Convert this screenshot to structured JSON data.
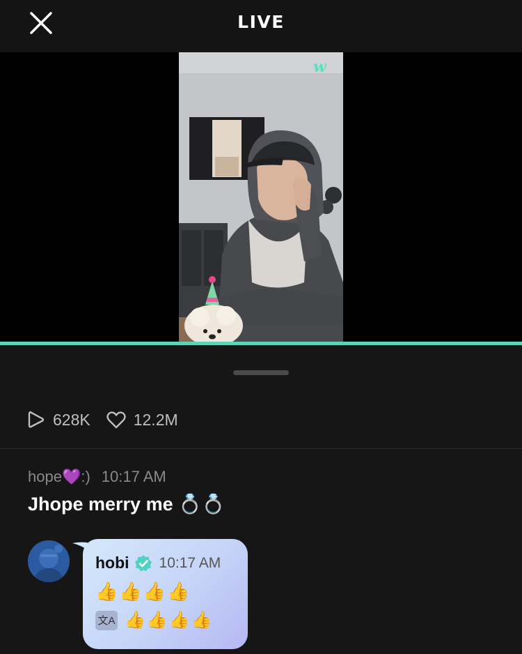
{
  "header": {
    "title": "LIVE",
    "close_icon": "close-icon"
  },
  "video": {
    "watermark_icon": "w-logo-icon",
    "progress_fraction": 1.0
  },
  "stats": {
    "plays": "628K",
    "likes": "12.2M",
    "play_icon": "play-icon",
    "like_icon": "heart-icon"
  },
  "comment": {
    "user": "hope💜:)",
    "time": "10:17 AM",
    "text": "Jhope merry me 💍💍"
  },
  "artist_comment": {
    "name": "hobi",
    "time": "10:17 AM",
    "text": "👍👍👍👍",
    "translated": "👍👍👍👍",
    "translate_icon_label": "文A",
    "verified_icon": "verified-badge-icon"
  },
  "colors": {
    "accent": "#5fd3b8",
    "background": "#141414",
    "bubble": "#c6d4f8"
  }
}
